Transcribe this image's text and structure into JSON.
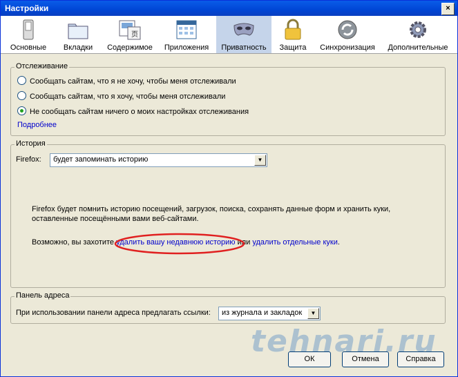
{
  "window": {
    "title": "Настройки",
    "close": "×"
  },
  "toolbar": {
    "items": [
      {
        "label": "Основные"
      },
      {
        "label": "Вкладки"
      },
      {
        "label": "Содержимое"
      },
      {
        "label": "Приложения"
      },
      {
        "label": "Приватность"
      },
      {
        "label": "Защита"
      },
      {
        "label": "Синхронизация"
      },
      {
        "label": "Дополнительные"
      }
    ]
  },
  "tracking": {
    "legend": "Отслеживание",
    "options": [
      "Сообщать сайтам, что я не хочу, чтобы меня отслеживали",
      "Сообщать сайтам, что я хочу, чтобы меня отслеживали",
      "Не сообщать сайтам ничего о моих настройках отслеживания"
    ],
    "selected_index": 2,
    "more_link": "Подробнее"
  },
  "history": {
    "legend": "История",
    "firefox_label": "Firefox:",
    "mode_value": "будет запоминать историю",
    "desc_line1": "Firefox будет помнить историю посещений, загрузок, поиска, сохранять данные форм и хранить куки,",
    "desc_line2": "оставленные посещёнными вами веб-сайтами.",
    "maybe_prefix": "Возможно, вы захотите",
    "clear_recent_link": "удалить вашу недавнюю историю",
    "or_text": "или",
    "remove_cookies_link": "удалить отдельные куки",
    "period": "."
  },
  "address_bar": {
    "legend": "Панель адреса",
    "label": "При использовании панели адреса предлагать ссылки:",
    "value": "из журнала и закладок"
  },
  "buttons": {
    "ok": "ОК",
    "cancel": "Отмена",
    "help": "Справка"
  },
  "watermark": "tehnari.ru",
  "colors": {
    "accent_active_tab": "#c5d4ea",
    "link": "#0000cc",
    "highlight_ellipse": "#e02020"
  }
}
